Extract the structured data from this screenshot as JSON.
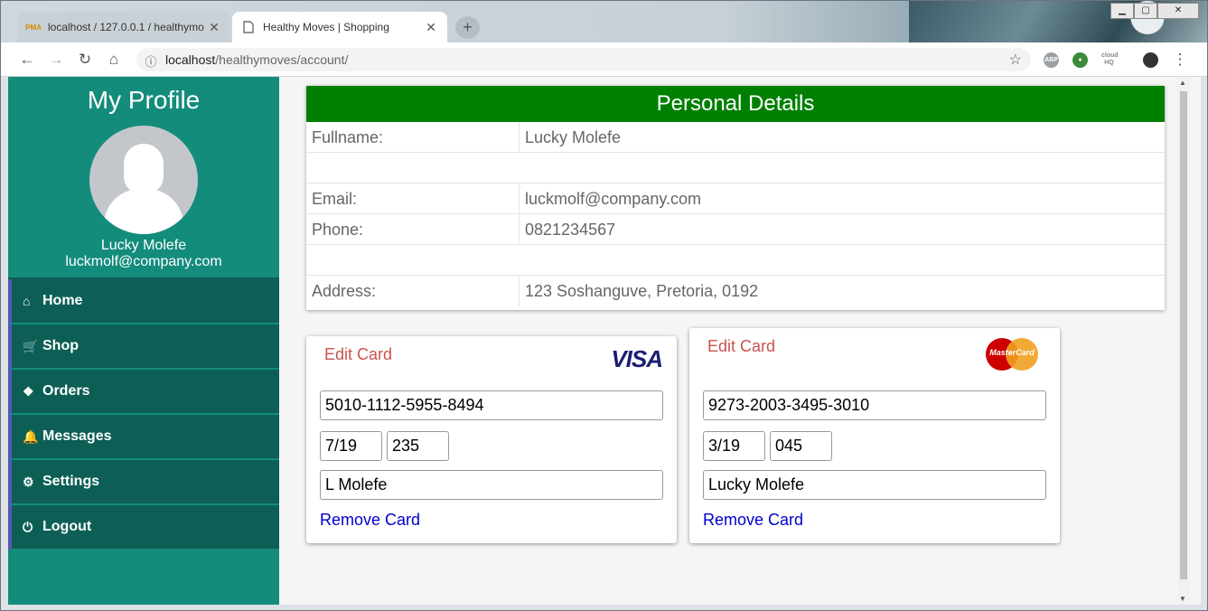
{
  "browser": {
    "tabs": [
      {
        "title": "localhost / 127.0.0.1 / healthymo",
        "favicon": "phpmyadmin-icon",
        "favicon_text": "PMA"
      },
      {
        "title": "Healthy Moves | Shopping",
        "favicon": "page-icon"
      }
    ],
    "url_host": "localhost",
    "url_path": "/healthymoves/account/",
    "extensions": [
      "ABP",
      "cloud HQ"
    ]
  },
  "sidebar": {
    "title": "My Profile",
    "user_name": "Lucky Molefe",
    "user_email": "luckmolf@company.com",
    "items": [
      {
        "label": "Home",
        "icon": "home-icon",
        "glyph": "⌂"
      },
      {
        "label": "Shop",
        "icon": "cart-icon",
        "glyph": "🛒"
      },
      {
        "label": "Orders",
        "icon": "cubes-icon",
        "glyph": "❖"
      },
      {
        "label": "Messages",
        "icon": "bell-icon",
        "glyph": "🔔"
      },
      {
        "label": "Settings",
        "icon": "gears-icon",
        "glyph": "⚙"
      },
      {
        "label": "Logout",
        "icon": "power-icon",
        "glyph": "⏻"
      }
    ]
  },
  "details": {
    "header": "Personal Details",
    "rows": [
      {
        "label": "Fullname:",
        "value": "Lucky Molefe"
      },
      {
        "label": "",
        "value": ""
      },
      {
        "label": "Email:",
        "value": "luckmolf@company.com"
      },
      {
        "label": "Phone:",
        "value": "0821234567"
      },
      {
        "label": "",
        "value": ""
      },
      {
        "label": "Address:",
        "value": "123 Soshanguve, Pretoria, 0192"
      }
    ]
  },
  "cards": [
    {
      "edit_label": "Edit Card",
      "brand": "VISA",
      "number": "5010-1112-5955-8494",
      "expiry": "7/19",
      "cvv": "235",
      "holder": "L Molefe",
      "remove_label": "Remove Card"
    },
    {
      "edit_label": "Edit Card",
      "brand": "MasterCard",
      "number": "9273-2003-3495-3010",
      "expiry": "3/19",
      "cvv": "045",
      "holder": "Lucky Molefe",
      "remove_label": "Remove Card"
    }
  ],
  "colors": {
    "sidebar": "#148c7c",
    "menu": "#0d5f55",
    "details_header": "#008000",
    "edit_link": "#c9534f",
    "remove_link": "#0000cc"
  }
}
